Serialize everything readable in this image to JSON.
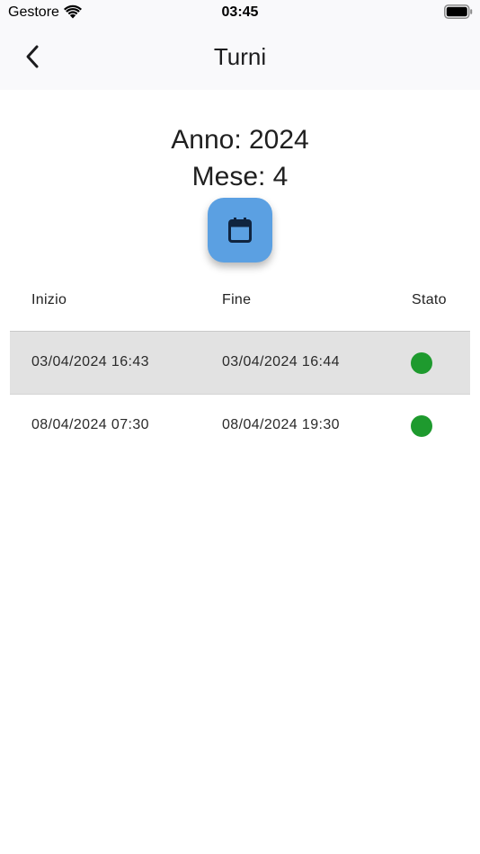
{
  "status_bar": {
    "carrier": "Gestore",
    "time": "03:45",
    "wifi_icon": "wifi-icon",
    "battery_icon": "battery-icon"
  },
  "nav": {
    "title": "Turni",
    "back_icon": "chevron-left-icon"
  },
  "period": {
    "year_text": "Anno: 2024",
    "month_text": "Mese: 4",
    "calendar_icon": "calendar-icon",
    "button_color": "#5ba0e2"
  },
  "table": {
    "headers": [
      "Inizio",
      "Fine",
      "Stato"
    ],
    "rows": [
      {
        "start": "03/04/2024 16:43",
        "end": "03/04/2024 16:44",
        "status_color": "#1e9a2e",
        "selected": true
      },
      {
        "start": "08/04/2024 07:30",
        "end": "08/04/2024 19:30",
        "status_color": "#1e9a2e",
        "selected": false
      }
    ]
  }
}
